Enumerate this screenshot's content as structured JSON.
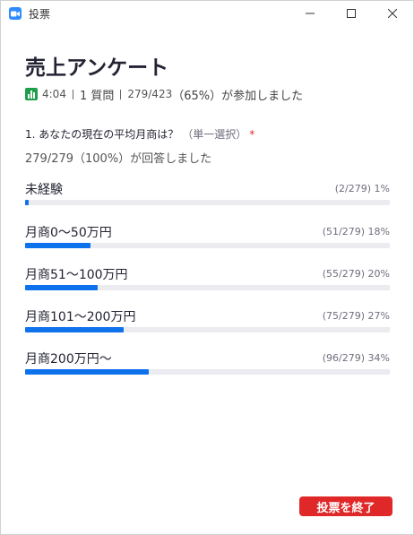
{
  "window": {
    "title": "投票"
  },
  "poll": {
    "title": "売上アンケート",
    "duration": "4:04",
    "question_count": "1 質問",
    "participation_count": "279/423",
    "participation_pct": "（65%）",
    "participation_text": "が参加しました"
  },
  "question": {
    "text": "1. あなたの現在の平均月商は？",
    "type": "（単一選択）",
    "required_mark": "*",
    "answered_summary": "279/279（100%）が回答しました"
  },
  "options": [
    {
      "label": "未経験",
      "stat": "(2/279) 1%",
      "fraction": 0.01
    },
    {
      "label": "月商0〜50万円",
      "stat": "(51/279) 18%",
      "fraction": 0.18
    },
    {
      "label": "月商51〜100万円",
      "stat": "(55/279) 20%",
      "fraction": 0.2
    },
    {
      "label": "月商101〜200万円",
      "stat": "(75/279) 27%",
      "fraction": 0.27
    },
    {
      "label": "月商200万円〜",
      "stat": "(96/279) 34%",
      "fraction": 0.34
    }
  ],
  "footer": {
    "end_button_label": "投票を終了"
  },
  "colors": {
    "bar_fill": "#0e72ed",
    "bar_track": "#ebebf0",
    "end_button": "#e02828",
    "poll_icon": "#1e9e4a",
    "app_icon": "#2d8cff"
  },
  "icons": {
    "app": "zoom-camera-icon",
    "poll": "bar-chart-icon",
    "minimize": "minimize-icon",
    "maximize": "maximize-icon",
    "close": "close-icon"
  }
}
